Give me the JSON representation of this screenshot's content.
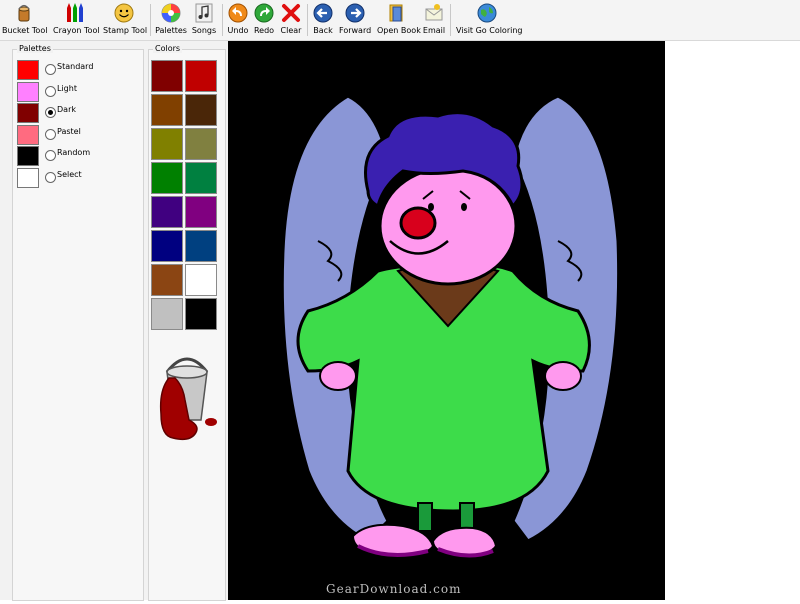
{
  "toolbar": {
    "bucket": "Bucket Tool",
    "crayon": "Crayon Tool",
    "stamp": "Stamp Tool",
    "palettes": "Palettes",
    "songs": "Songs",
    "undo": "Undo",
    "redo": "Redo",
    "clear": "Clear",
    "back": "Back",
    "forward": "Forward",
    "open_book": "Open Book",
    "email": "Email",
    "visit": "Visit Go Coloring"
  },
  "palettes_panel": {
    "title": "Palettes",
    "items": [
      {
        "label": "Standard",
        "swatch": "#ff0000",
        "selected": false
      },
      {
        "label": "Light",
        "swatch": "#ff80ff",
        "selected": false
      },
      {
        "label": "Dark",
        "swatch": "#800000",
        "selected": true
      },
      {
        "label": "Pastel",
        "swatch": "#ff6b80",
        "selected": false
      },
      {
        "label": "Random",
        "swatch": "#000000",
        "selected": false
      },
      {
        "label": "Select",
        "swatch": "#ffffff",
        "selected": false
      }
    ]
  },
  "colors_panel": {
    "title": "Colors",
    "swatches": [
      "#800000",
      "#c00000",
      "#804000",
      "#4a2608",
      "#808000",
      "#808040",
      "#008000",
      "#008040",
      "#400080",
      "#800080",
      "#000080",
      "#004080",
      "#8b4513",
      "#ffffff",
      "#c0c0c0",
      "#000000"
    ]
  },
  "current_tool": "paint-bucket-icon",
  "watermark": "GearDownload.com"
}
